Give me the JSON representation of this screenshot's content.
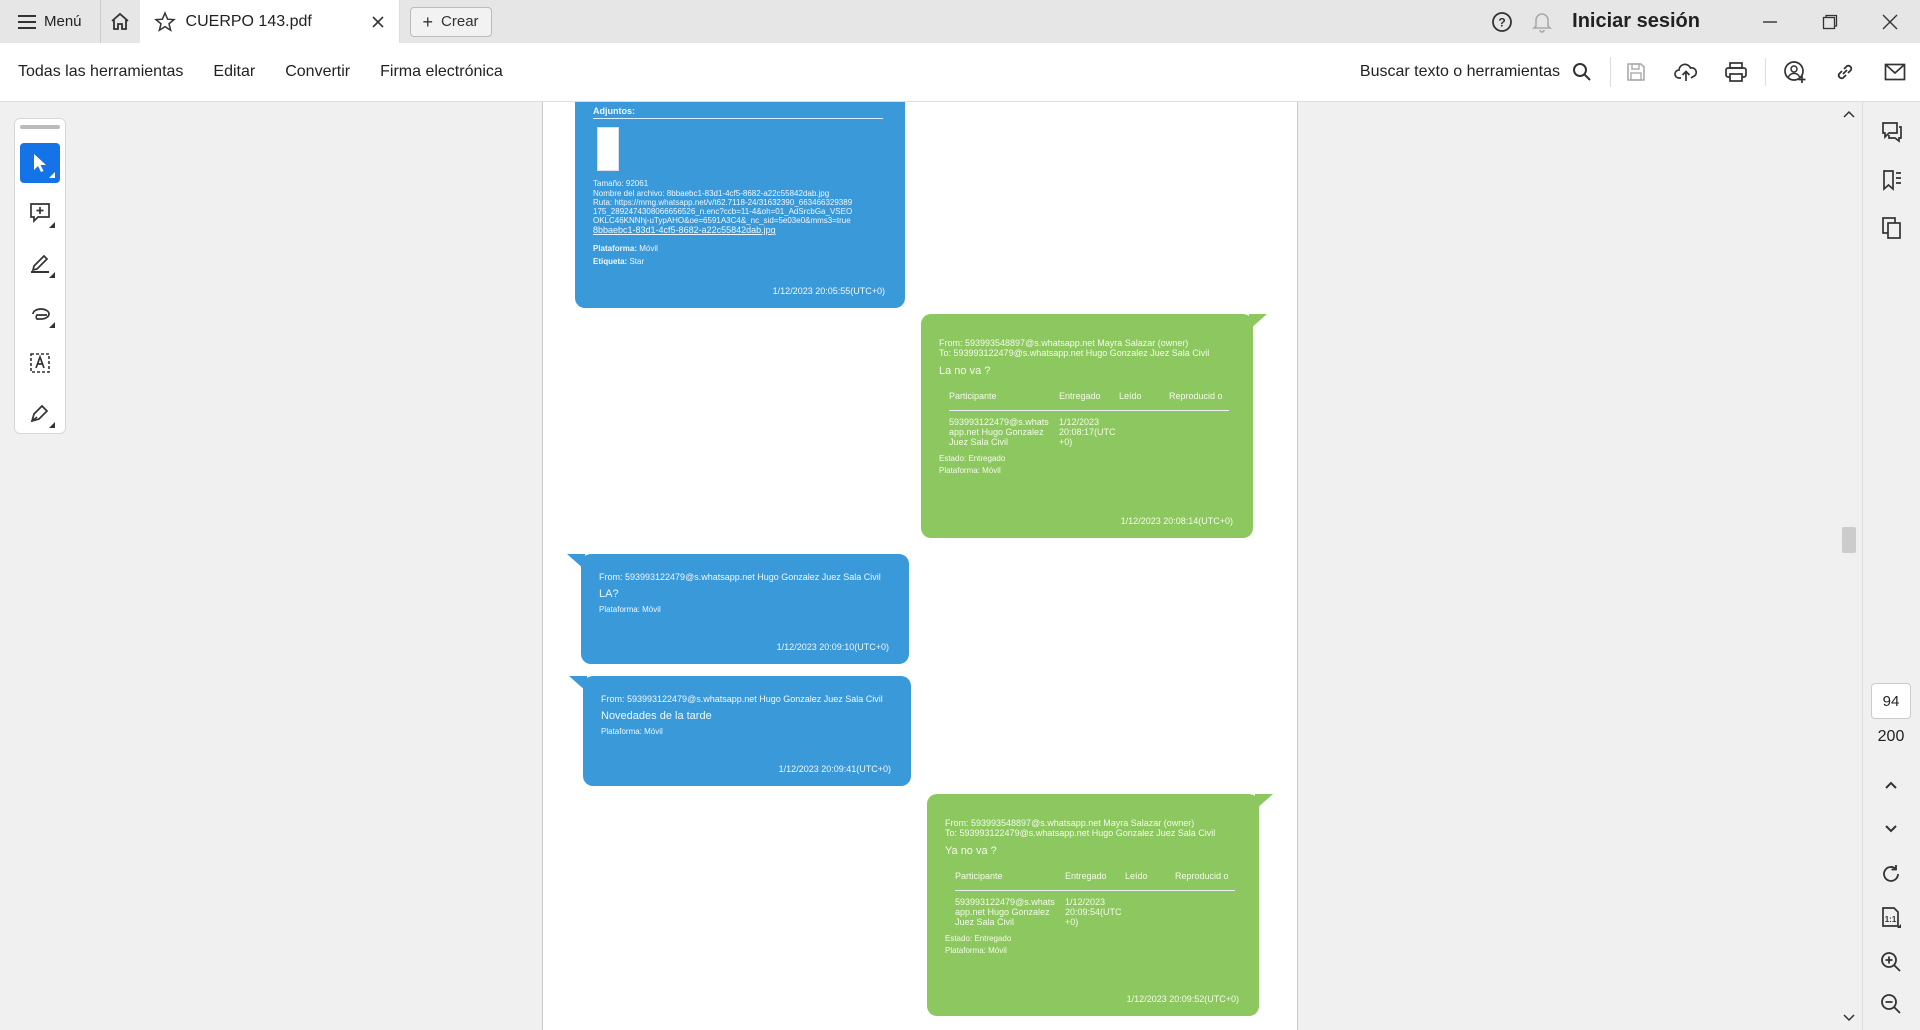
{
  "titlebar": {
    "menu_label": "Menú",
    "tab_title": "CUERPO 143.pdf",
    "create_label": "Crear",
    "signin_label": "Iniciar sesión"
  },
  "toolbar": {
    "all_tools": "Todas las herramientas",
    "edit": "Editar",
    "convert": "Convertir",
    "esign": "Firma electrónica",
    "search_label": "Buscar texto o herramientas"
  },
  "left_tools": [
    "select-icon",
    "add-comment-icon",
    "highlight-pen-icon",
    "lasso-draw-icon",
    "text-box-icon",
    "sign-icon"
  ],
  "navigation": {
    "current_page": "94",
    "total_pages": "200"
  },
  "document": {
    "msg1": {
      "attachments_label": "Adjuntos:",
      "size": "Tamaño: 92061",
      "filename": "Nombre del archivo: 8bbaebc1-83d1-4cf5-8682-a22c55842dab.jpg",
      "path": "Ruta: https://mmg.whatsapp.net/v/t62.7118-24/31632390_663466329389175_2892474308066656526_n.enc?ccb=11-4&oh=01_AdSrcbGa_VSEOOKLC46KNNhj-uTypAHO&oe=6591A3C4&_nc_sid=5e03e0&mms3=true",
      "link": "8bbaebc1-83d1-4cf5-8682-a22c55842dab.jpg",
      "platform": "Plataforma:",
      "platform_val": "Móvil",
      "label": "Etiqueta:",
      "label_val": "Star",
      "time": "1/12/2023 20:05:55(UTC+0)"
    },
    "msg2": {
      "from": "From: 593993548897@s.whatsapp.net Mayra Salazar (owner)",
      "to": "To: 593993122479@s.whatsapp.net Hugo Gonzalez Juez Sala Civil",
      "body": "La no va ?",
      "col_participant": "Participante",
      "col_delivered": "Entregado",
      "col_read": "Leído",
      "col_played": "Reproducid o",
      "participant": "593993122479@s.whats app.net Hugo Gonzalez Juez Sala Civil",
      "delivered": "1/12/2023 20:08:17(UTC +0)",
      "status": "Estado: Entregado",
      "platform": "Plataforma: Móvil",
      "time": "1/12/2023 20:08:14(UTC+0)"
    },
    "msg3": {
      "from": "From: 593993122479@s.whatsapp.net Hugo Gonzalez Juez Sala Civil",
      "body": "LA?",
      "platform": "Plataforma: Móvil",
      "time": "1/12/2023 20:09:10(UTC+0)"
    },
    "msg4": {
      "from": "From: 593993122479@s.whatsapp.net Hugo Gonzalez Juez Sala Civil",
      "body": "Novedades de la tarde",
      "platform": "Plataforma: Móvil",
      "time": "1/12/2023 20:09:41(UTC+0)"
    },
    "msg5": {
      "from": "From: 593993548897@s.whatsapp.net Mayra Salazar (owner)",
      "to": "To: 593993122479@s.whatsapp.net Hugo Gonzalez Juez Sala Civil",
      "body": "Ya no va ?",
      "col_participant": "Participante",
      "col_delivered": "Entregado",
      "col_read": "Leído",
      "col_played": "Reproducid o",
      "participant": "593993122479@s.whats app.net Hugo Gonzalez Juez Sala Civil",
      "delivered": "1/12/2023 20:09:54(UTC +0)",
      "status": "Estado: Entregado",
      "platform": "Plataforma: Móvil",
      "time": "1/12/2023 20:09:52(UTC+0)"
    }
  },
  "colors": {
    "accent": "#1473e6",
    "bubble_blue": "#3a9ad9",
    "bubble_green": "#8cc85f"
  }
}
